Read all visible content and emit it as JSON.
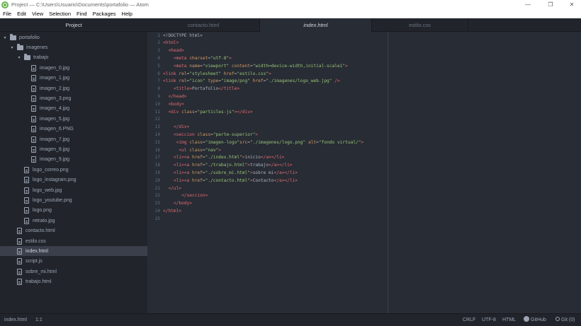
{
  "window": {
    "title": "Project — C:\\Users\\Usuario\\Documents\\portafolio — Atom",
    "minimize": "—",
    "maximize": "❐",
    "close": "✕"
  },
  "menu": [
    "File",
    "Edit",
    "View",
    "Selection",
    "Find",
    "Packages",
    "Help"
  ],
  "tree": {
    "header": "Project",
    "root": "portafolio",
    "folder_imagenes": "imagenes",
    "folder_trabajo": "trabajo",
    "trabajo_files": [
      "imagen_0.jpg",
      "imagen_1.jpg",
      "imagen_2.jpg",
      "imagen_3.png",
      "imagen_4.jpg",
      "imagen_5.jpg",
      "imagen_6.PNG",
      "imagen_7.jpg",
      "imagen_8.jpg",
      "imagen_9.jpg"
    ],
    "imagenes_files": [
      "logo_correo.png",
      "logo_instagram.png",
      "logo_web.jpg",
      "logo_youtube.png",
      "logo.png",
      "retrato.jpg"
    ],
    "root_files": [
      "contacto.html",
      "estilo.css",
      "index.html",
      "script.js",
      "sobre_mi.html",
      "trabajo.html"
    ],
    "selected": "index.html"
  },
  "tabs": [
    "contacto.html",
    "index.html",
    "estilo.css"
  ],
  "active_tab": "index.html",
  "code_lines": [
    [
      [
        "p",
        "<!DOCTYPE html>"
      ]
    ],
    [
      [
        "t",
        "<html>"
      ]
    ],
    [
      [
        "p",
        "  "
      ],
      [
        "t",
        "<head>"
      ]
    ],
    [
      [
        "p",
        "    "
      ],
      [
        "t",
        "<meta "
      ],
      [
        "a",
        "charset"
      ],
      [
        "p",
        "="
      ],
      [
        "s",
        "\"utf-8\""
      ],
      [
        "t",
        ">"
      ]
    ],
    [
      [
        "p",
        "    "
      ],
      [
        "t",
        "<meta "
      ],
      [
        "a",
        "name"
      ],
      [
        "p",
        "="
      ],
      [
        "s",
        "\"viewport\""
      ],
      [
        "p",
        " "
      ],
      [
        "a",
        "content"
      ],
      [
        "p",
        "="
      ],
      [
        "s",
        "\"width=device-width,initial-scale1\""
      ],
      [
        "t",
        ">"
      ]
    ],
    [
      [
        "t",
        "<link "
      ],
      [
        "a",
        "rel"
      ],
      [
        "p",
        "="
      ],
      [
        "s",
        "\"stylesheet\""
      ],
      [
        "p",
        " "
      ],
      [
        "a",
        "href"
      ],
      [
        "p",
        "="
      ],
      [
        "s",
        "\"estilo.css\""
      ],
      [
        "t",
        ">"
      ]
    ],
    [
      [
        "t",
        "<link "
      ],
      [
        "a",
        "rel"
      ],
      [
        "p",
        "="
      ],
      [
        "s",
        "\"icon\""
      ],
      [
        "p",
        " "
      ],
      [
        "a",
        "type"
      ],
      [
        "p",
        "="
      ],
      [
        "s",
        "\"image/png\""
      ],
      [
        "p",
        " "
      ],
      [
        "a",
        "href"
      ],
      [
        "p",
        "="
      ],
      [
        "s",
        "\"./imagenes/logo_web.jpg\""
      ],
      [
        "t",
        " />"
      ]
    ],
    [
      [
        "p",
        "    "
      ],
      [
        "t",
        "<title>"
      ],
      [
        "txt",
        "Portafolio"
      ],
      [
        "t",
        "</title>"
      ]
    ],
    [
      [
        "p",
        "  "
      ],
      [
        "t",
        "</head>"
      ]
    ],
    [
      [
        "p",
        "  "
      ],
      [
        "t",
        "<body>"
      ]
    ],
    [
      [
        "p",
        "  "
      ],
      [
        "t",
        "<div "
      ],
      [
        "a",
        "class"
      ],
      [
        "p",
        "="
      ],
      [
        "s",
        "\"particles-js\""
      ],
      [
        "t",
        "></div>"
      ]
    ],
    [],
    [
      [
        "p",
        "    "
      ],
      [
        "t",
        "</div>"
      ]
    ],
    [
      [
        "p",
        "    "
      ],
      [
        "t",
        "<seccion "
      ],
      [
        "a",
        "class"
      ],
      [
        "p",
        "="
      ],
      [
        "s",
        "\"parte-superior\""
      ],
      [
        "t",
        ">"
      ]
    ],
    [
      [
        "p",
        "     "
      ],
      [
        "t",
        "<img "
      ],
      [
        "a",
        "class"
      ],
      [
        "p",
        "="
      ],
      [
        "s",
        "\"imagen-logo\""
      ],
      [
        "a",
        "src"
      ],
      [
        "p",
        "="
      ],
      [
        "s",
        "\"./imagenes/logo.png\""
      ],
      [
        "p",
        " "
      ],
      [
        "a",
        "alt"
      ],
      [
        "p",
        "="
      ],
      [
        "s",
        "\"fondo virtual/\""
      ],
      [
        "t",
        ">"
      ]
    ],
    [
      [
        "p",
        "      "
      ],
      [
        "t",
        "<ul "
      ],
      [
        "a",
        "class"
      ],
      [
        "p",
        "="
      ],
      [
        "s",
        "\"nav\""
      ],
      [
        "t",
        ">"
      ]
    ],
    [
      [
        "p",
        "    "
      ],
      [
        "t",
        "<li><a "
      ],
      [
        "a",
        "href"
      ],
      [
        "p",
        "="
      ],
      [
        "s",
        "\"./index.html\""
      ],
      [
        "t",
        ">"
      ],
      [
        "txt",
        "inicio"
      ],
      [
        "t",
        "</a></li>"
      ]
    ],
    [
      [
        "p",
        "    "
      ],
      [
        "t",
        "<li><a "
      ],
      [
        "a",
        "href"
      ],
      [
        "p",
        "="
      ],
      [
        "s",
        "\"./trabajo.html\""
      ],
      [
        "t",
        ">"
      ],
      [
        "txt",
        "trabajo"
      ],
      [
        "t",
        "</a></li>"
      ]
    ],
    [
      [
        "p",
        "    "
      ],
      [
        "t",
        "<li><a "
      ],
      [
        "a",
        "href"
      ],
      [
        "p",
        "="
      ],
      [
        "s",
        "\"./sobre_mi.html\""
      ],
      [
        "t",
        ">"
      ],
      [
        "txt",
        "sobre mi"
      ],
      [
        "t",
        "</a></li>"
      ]
    ],
    [
      [
        "p",
        "    "
      ],
      [
        "t",
        "<li><a "
      ],
      [
        "a",
        "href"
      ],
      [
        "p",
        "="
      ],
      [
        "s",
        "\"./contacto.html\""
      ],
      [
        "t",
        ">"
      ],
      [
        "txt",
        "Contacto"
      ],
      [
        "t",
        "</a></li>"
      ]
    ],
    [
      [
        "p",
        "  "
      ],
      [
        "t",
        "</ul>"
      ]
    ],
    [
      [
        "p",
        "       "
      ],
      [
        "t",
        "</seccion>"
      ]
    ],
    [
      [
        "p",
        "    "
      ],
      [
        "t",
        "</body>"
      ]
    ],
    [
      [
        "t",
        "</html>"
      ]
    ],
    []
  ],
  "status": {
    "file": "index.html",
    "cursor": "1:1",
    "line_ending": "CRLF",
    "encoding": "UTF-8",
    "grammar": "HTML",
    "github": "GitHub",
    "git": "Git (0)"
  }
}
